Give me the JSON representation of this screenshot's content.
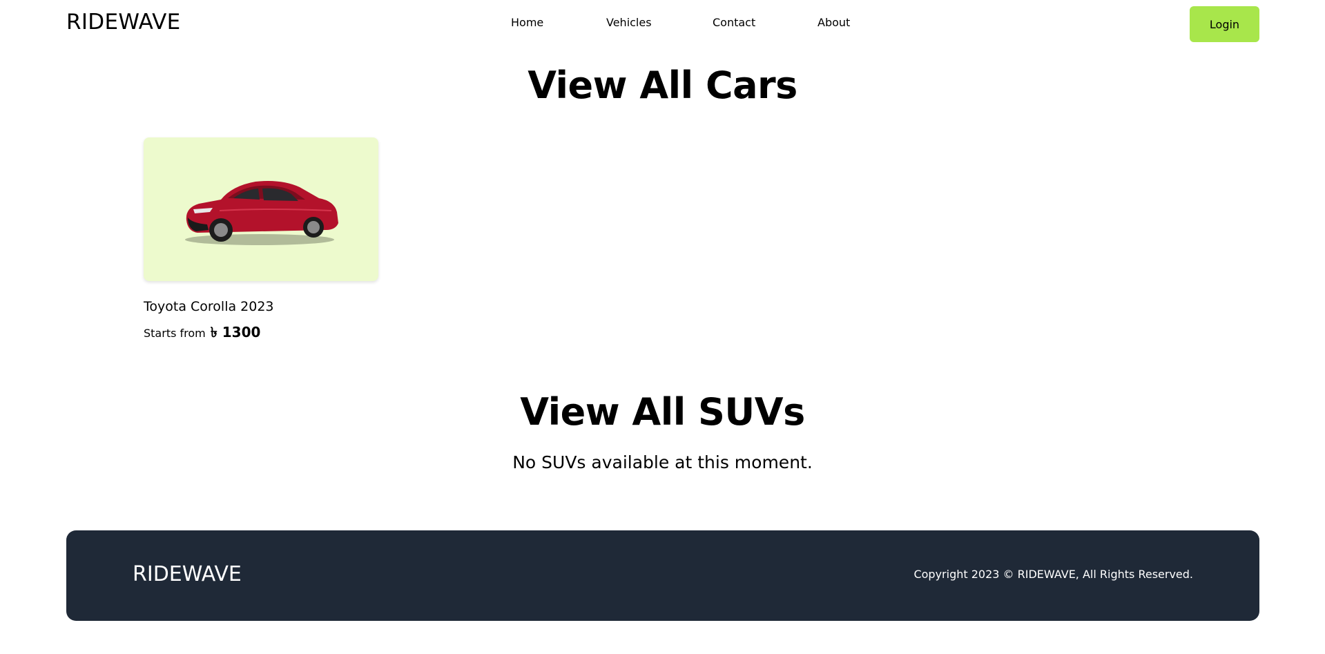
{
  "header": {
    "logo": "RIDEWAVE",
    "nav": [
      "Home",
      "Vehicles",
      "Contact",
      "About"
    ],
    "login_label": "Login"
  },
  "cars_section": {
    "title": "View All Cars",
    "cars": [
      {
        "name": "Toyota Corolla 2023",
        "price_prefix": "Starts from",
        "price": "৳ 1300",
        "image_icon": "red-sedan-car-image"
      }
    ]
  },
  "suvs_section": {
    "title": "View All SUVs",
    "empty_message": "No SUVs available at this moment."
  },
  "footer": {
    "logo": "RIDEWAVE",
    "copyright": "Copyright 2023 © RIDEWAVE, All Rights Reserved."
  },
  "colors": {
    "accent": "#a8e64b",
    "card_bg": "#edfacd",
    "footer_bg": "#1f2937",
    "car_red": "#b3122b"
  }
}
